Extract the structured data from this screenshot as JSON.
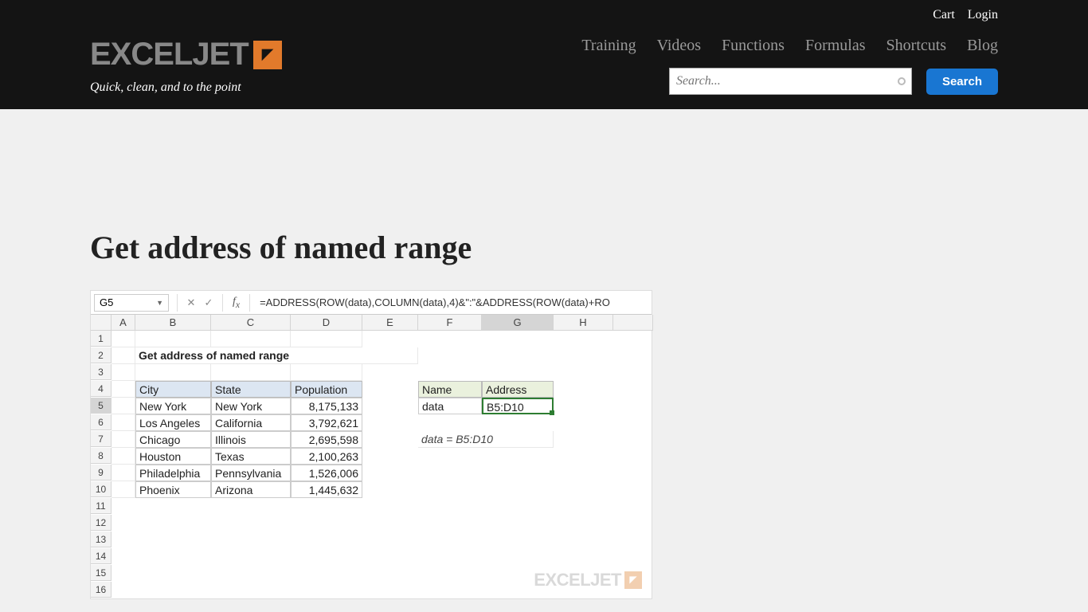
{
  "top_links": {
    "cart": "Cart",
    "login": "Login"
  },
  "logo": {
    "text": "EXCELJET",
    "tagline": "Quick, clean, and to the point"
  },
  "nav": {
    "training": "Training",
    "videos": "Videos",
    "functions": "Functions",
    "formulas": "Formulas",
    "shortcuts": "Shortcuts",
    "blog": "Blog"
  },
  "search": {
    "placeholder": "Search...",
    "button": "Search"
  },
  "page_title": "Get address of named range",
  "excel": {
    "name_box": "G5",
    "formula": "=ADDRESS(ROW(data),COLUMN(data),4)&\":\"&ADDRESS(ROW(data)+RO",
    "cols": [
      "A",
      "B",
      "C",
      "D",
      "E",
      "F",
      "G",
      "H"
    ],
    "rows": [
      "1",
      "2",
      "3",
      "4",
      "5",
      "6",
      "7",
      "8",
      "9",
      "10",
      "11",
      "12",
      "13",
      "14",
      "15",
      "16"
    ],
    "title_cell": "Get address of named range",
    "headers": {
      "city": "City",
      "state": "State",
      "pop": "Population",
      "name": "Name",
      "address": "Address"
    },
    "table": [
      {
        "city": "New York",
        "state": "New York",
        "pop": "8,175,133"
      },
      {
        "city": "Los Angeles",
        "state": "California",
        "pop": "3,792,621"
      },
      {
        "city": "Chicago",
        "state": "Illinois",
        "pop": "2,695,598"
      },
      {
        "city": "Houston",
        "state": "Texas",
        "pop": "2,100,263"
      },
      {
        "city": "Philadelphia",
        "state": "Pennsylvania",
        "pop": "1,526,006"
      },
      {
        "city": "Phoenix",
        "state": "Arizona",
        "pop": "1,445,632"
      }
    ],
    "lookup": {
      "name_val": "data",
      "address_val": "B5:D10"
    },
    "note": "data = B5:D10",
    "watermark": "EXCELJET"
  }
}
